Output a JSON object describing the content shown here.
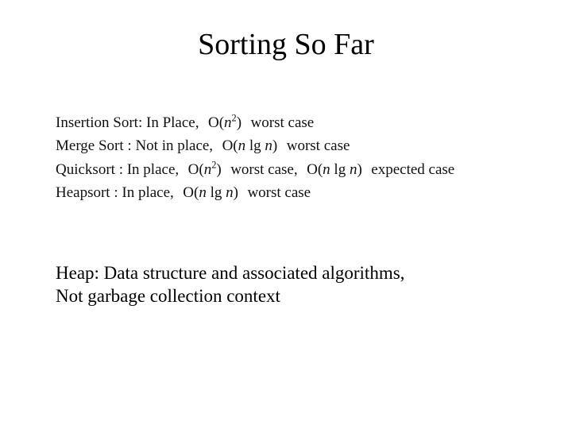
{
  "title": "Sorting So Far",
  "algorithms": [
    {
      "name": "Insertion Sort",
      "sep": ":  ",
      "placement": "In Place,",
      "complexity_html": "O(n<sup>2</sup>)",
      "case": "worst case",
      "extra_complexity_html": "",
      "extra_case": ""
    },
    {
      "name": "Merge Sort",
      "sep": " : ",
      "placement": "Not in place,",
      "complexity_html": "O(n lg n)",
      "case": "worst case",
      "extra_complexity_html": "",
      "extra_case": ""
    },
    {
      "name": "Quicksort",
      "sep": " : ",
      "placement": "In place,",
      "complexity_html": "O(n<sup>2</sup>)",
      "case": "worst case,",
      "extra_complexity_html": "O(n lg n)",
      "extra_case": "expected case"
    },
    {
      "name": "Heapsort",
      "sep": " : ",
      "placement": "In place,",
      "complexity_html": "O(n lg n)",
      "case": "worst case",
      "extra_complexity_html": "",
      "extra_case": ""
    }
  ],
  "note_line1": "Heap: Data structure and associated algorithms,",
  "note_line2": "Not garbage collection context"
}
